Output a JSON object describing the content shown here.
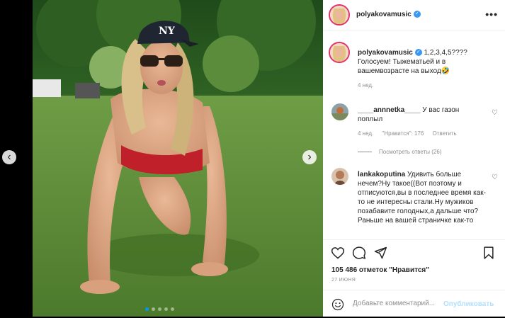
{
  "post": {
    "author": "polyakovamusic",
    "caption_author": "polyakovamusic",
    "caption": "1,2,3,4,5???? Голосуем! Тыжематьей и в вашемвозрасте на выход🤣",
    "caption_time": "4 нед.",
    "more_icon": "•••"
  },
  "comments": [
    {
      "author": "____annnetka____",
      "text": "У вас газон поплыл",
      "time": "4 нед.",
      "likes": "\"Нравится\": 176",
      "reply": "Ответить",
      "view_replies": "Посмотреть ответы (26)"
    },
    {
      "author": "lankakoputina",
      "text": "Удивить больше нечем?Ну такое((Вот поэтому и отписуются,вы в последнее время как-то не интересны стали.Ну мужиков позабавите голодных,а дальше что?Раньше на вашей страничке как-то"
    }
  ],
  "actions": {
    "likes_text": "105 486 отметок \"Нравится\"",
    "date": "27 ИЮНЯ",
    "comment_placeholder": "Добавьте комментарий...",
    "post_label": "Опубликовать"
  },
  "carousel": {
    "prev_icon": "‹",
    "next_icon": "›",
    "dot_count": 5,
    "active_dot": 1
  },
  "colors": {
    "accent": "#0095f6",
    "verified": "#3897f0",
    "muted": "#8e8e8e",
    "post_disabled": "#b2dffc"
  }
}
